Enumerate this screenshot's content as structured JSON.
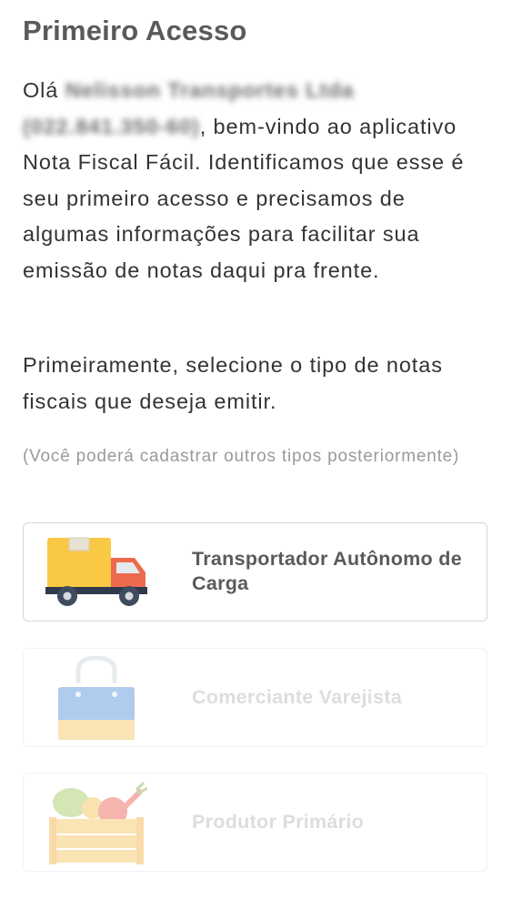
{
  "header": {
    "title": "Primeiro Acesso"
  },
  "intro": {
    "greeting": "Olá",
    "company_name": "Nelisson Transportes Ltda",
    "company_doc": "(022.841.350-60)",
    "text_after_name": ", bem-vindo ao aplicativo Nota Fiscal Fácil. Identificamos que esse é seu primeiro acesso e precisamos de algumas informações para facilitar sua emissão de notas daqui pra frente."
  },
  "prompt": "Primeiramente, selecione o tipo de notas fiscais que deseja emitir.",
  "hint": "(Você poderá cadastrar outros tipos posteriormente)",
  "options": [
    {
      "label": "Transportador Autônomo de Carga",
      "icon": "delivery-truck-icon",
      "enabled": true
    },
    {
      "label": "Comerciante Varejista",
      "icon": "shopping-bag-icon",
      "enabled": false
    },
    {
      "label": "Produtor Primário",
      "icon": "produce-crate-icon",
      "enabled": false
    }
  ],
  "colors": {
    "title": "#5a5a5a",
    "body_text": "#333333",
    "hint_text": "#9a9a9a",
    "card_border": "#d6d6d6",
    "truck_cargo": "#f9c845",
    "truck_cab": "#ee6a4f"
  }
}
